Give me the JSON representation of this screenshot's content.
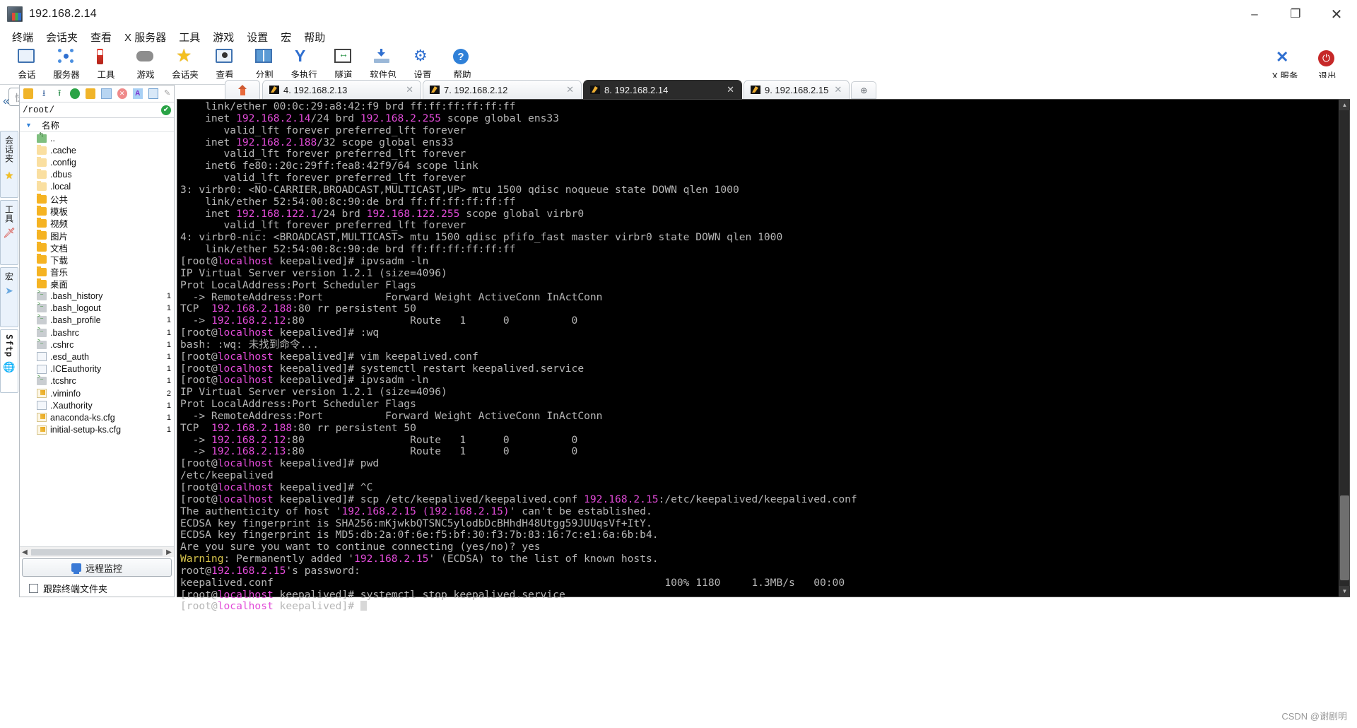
{
  "window": {
    "title": "192.168.2.14",
    "app_icon": "mobaxterm-icon",
    "minimize": "–",
    "maximize": "❐",
    "close": "✕"
  },
  "menubar": {
    "items": [
      {
        "label": "终端",
        "name": "menu-terminal"
      },
      {
        "label": "会话夹",
        "name": "menu-sessions"
      },
      {
        "label": "查看",
        "name": "menu-view"
      },
      {
        "label": "X 服务器",
        "name": "menu-xserver"
      },
      {
        "label": "工具",
        "name": "menu-tools"
      },
      {
        "label": "游戏",
        "name": "menu-games"
      },
      {
        "label": "设置",
        "name": "menu-settings"
      },
      {
        "label": "宏",
        "name": "menu-macros"
      },
      {
        "label": "帮助",
        "name": "menu-help"
      }
    ]
  },
  "toolbar": {
    "buttons": [
      {
        "label": "会话",
        "icon": "session-icon",
        "name": "toolbar-session"
      },
      {
        "label": "服务器",
        "icon": "servers-icon",
        "name": "toolbar-servers"
      },
      {
        "label": "工具",
        "icon": "tools-icon",
        "name": "toolbar-tools"
      },
      {
        "label": "游戏",
        "icon": "games-icon",
        "name": "toolbar-games"
      },
      {
        "label": "会话夹",
        "icon": "star-icon",
        "name": "toolbar-sessions-folder"
      },
      {
        "label": "查看",
        "icon": "view-icon",
        "name": "toolbar-view"
      },
      {
        "label": "分割",
        "icon": "split-icon",
        "name": "toolbar-split"
      },
      {
        "label": "多执行",
        "icon": "multiexec-icon",
        "name": "toolbar-multiexec"
      },
      {
        "label": "隧道",
        "icon": "tunnel-icon",
        "name": "toolbar-tunneling"
      },
      {
        "label": "软件包",
        "icon": "package-icon",
        "name": "toolbar-packages"
      },
      {
        "label": "设置",
        "icon": "gear-icon",
        "name": "toolbar-settings"
      },
      {
        "label": "帮助",
        "icon": "help-icon",
        "name": "toolbar-help"
      }
    ],
    "right_buttons": [
      {
        "label": "X 服务",
        "icon": "x-server-icon",
        "name": "toolbar-xserver"
      },
      {
        "label": "退出",
        "icon": "power-icon",
        "name": "toolbar-exit"
      }
    ]
  },
  "quick_connect": {
    "placeholder": "快速连接..."
  },
  "vertical_tabs": [
    {
      "label": "会话夹",
      "icon": "star-icon",
      "name": "vtab-sessions"
    },
    {
      "label": "工具",
      "icon": "tools-icon",
      "name": "vtab-tools"
    },
    {
      "label": "宏",
      "icon": "macro-icon",
      "name": "vtab-macros"
    },
    {
      "label": "Sftp",
      "icon": "globe-icon",
      "name": "vtab-sftp"
    }
  ],
  "sftp": {
    "collapse_icon": "chevron-left-double-icon",
    "toolbar_icons": [
      {
        "name": "parent-folder-icon"
      },
      {
        "name": "download-icon"
      },
      {
        "name": "upload-icon"
      },
      {
        "name": "refresh-icon"
      },
      {
        "name": "new-folder-icon"
      },
      {
        "name": "new-file-icon"
      },
      {
        "name": "delete-icon"
      },
      {
        "name": "text-mode-icon"
      },
      {
        "name": "view-mode-icon"
      },
      {
        "name": "edit-icon"
      }
    ],
    "path": "/root/",
    "path_status": "✔",
    "column_header": "名称",
    "files": [
      {
        "name": "..",
        "type": "up",
        "size": ""
      },
      {
        "name": ".cache",
        "type": "folder-pale",
        "size": ""
      },
      {
        "name": ".config",
        "type": "folder-pale",
        "size": ""
      },
      {
        "name": ".dbus",
        "type": "folder-pale",
        "size": ""
      },
      {
        "name": ".local",
        "type": "folder-pale",
        "size": ""
      },
      {
        "name": "公共",
        "type": "folder",
        "size": ""
      },
      {
        "name": "模板",
        "type": "folder",
        "size": ""
      },
      {
        "name": "视频",
        "type": "folder",
        "size": ""
      },
      {
        "name": "图片",
        "type": "folder",
        "size": ""
      },
      {
        "name": "文档",
        "type": "folder",
        "size": ""
      },
      {
        "name": "下载",
        "type": "folder",
        "size": ""
      },
      {
        "name": "音乐",
        "type": "folder",
        "size": ""
      },
      {
        "name": "桌面",
        "type": "folder",
        "size": ""
      },
      {
        "name": ".bash_history",
        "type": "sh",
        "size": "1"
      },
      {
        "name": ".bash_logout",
        "type": "sh",
        "size": "1"
      },
      {
        "name": ".bash_profile",
        "type": "sh",
        "size": "1"
      },
      {
        "name": ".bashrc",
        "type": "sh",
        "size": "1"
      },
      {
        "name": ".cshrc",
        "type": "sh",
        "size": "1"
      },
      {
        "name": ".esd_auth",
        "type": "doc",
        "size": "1"
      },
      {
        "name": ".ICEauthority",
        "type": "doc",
        "size": "1"
      },
      {
        "name": ".tcshrc",
        "type": "sh",
        "size": "1"
      },
      {
        "name": ".viminfo",
        "type": "docy",
        "size": "2"
      },
      {
        "name": ".Xauthority",
        "type": "doc",
        "size": "1"
      },
      {
        "name": "anaconda-ks.cfg",
        "type": "docy",
        "size": "1"
      },
      {
        "name": "initial-setup-ks.cfg",
        "type": "docy",
        "size": "1"
      }
    ],
    "remote_monitor_label": "远程监控",
    "follow_terminal_label": "跟踪终端文件夹",
    "follow_terminal_checked": false,
    "scroll_left": "◀",
    "scroll_right": "▶"
  },
  "tabs": {
    "home_icon": "home-icon",
    "items": [
      {
        "label": "4. 192.168.2.13",
        "active": false,
        "close": "✕",
        "name": "tab-4"
      },
      {
        "label": "7. 192.168.2.12",
        "active": false,
        "close": "✕",
        "name": "tab-7"
      },
      {
        "label": "8. 192.168.2.14",
        "active": true,
        "close": "✕",
        "name": "tab-8"
      },
      {
        "label": "9. 192.168.2.15",
        "active": false,
        "close": "✕",
        "name": "tab-9"
      }
    ],
    "new_tab_label": "⊕"
  },
  "terminal": {
    "lines": [
      [
        {
          "t": "    link/ether 00:0c:29:a8:42:f9 brd ff:ff:ff:ff:ff:ff",
          "c": "g"
        }
      ],
      [
        {
          "t": "    inet ",
          "c": "g"
        },
        {
          "t": "192.168.2.14",
          "c": "m"
        },
        {
          "t": "/24 brd ",
          "c": "g"
        },
        {
          "t": "192.168.2.255",
          "c": "m"
        },
        {
          "t": " scope global ens33",
          "c": "g"
        }
      ],
      [
        {
          "t": "       valid_lft forever preferred_lft forever",
          "c": "g"
        }
      ],
      [
        {
          "t": "    inet ",
          "c": "g"
        },
        {
          "t": "192.168.2.188",
          "c": "m"
        },
        {
          "t": "/32 scope global ens33",
          "c": "g"
        }
      ],
      [
        {
          "t": "       valid_lft forever preferred_lft forever",
          "c": "g"
        }
      ],
      [
        {
          "t": "    inet6 fe80::20c:29ff:fea8:42f9/64 scope link",
          "c": "g"
        }
      ],
      [
        {
          "t": "       valid_lft forever preferred_lft forever",
          "c": "g"
        }
      ],
      [
        {
          "t": "3: virbr0: <NO-CARRIER,BROADCAST,MULTICAST,UP> mtu 1500 qdisc noqueue state DOWN qlen 1000",
          "c": "g"
        }
      ],
      [
        {
          "t": "    link/ether 52:54:00:8c:90:de brd ff:ff:ff:ff:ff:ff",
          "c": "g"
        }
      ],
      [
        {
          "t": "    inet ",
          "c": "g"
        },
        {
          "t": "192.168.122.1",
          "c": "m"
        },
        {
          "t": "/24 brd ",
          "c": "g"
        },
        {
          "t": "192.168.122.255",
          "c": "m"
        },
        {
          "t": " scope global virbr0",
          "c": "g"
        }
      ],
      [
        {
          "t": "       valid_lft forever preferred_lft forever",
          "c": "g"
        }
      ],
      [
        {
          "t": "4: virbr0-nic: <BROADCAST,MULTICAST> mtu 1500 qdisc pfifo_fast master virbr0 state DOWN qlen 1000",
          "c": "g"
        }
      ],
      [
        {
          "t": "    link/ether 52:54:00:8c:90:de brd ff:ff:ff:ff:ff:ff",
          "c": "g"
        }
      ],
      [
        {
          "t": "[root@",
          "c": "g"
        },
        {
          "t": "localhost",
          "c": "m"
        },
        {
          "t": " keepalived]# ipvsadm -ln",
          "c": "g"
        }
      ],
      [
        {
          "t": "IP Virtual Server version 1.2.1 (size=4096)",
          "c": "g"
        }
      ],
      [
        {
          "t": "Prot LocalAddress:Port Scheduler Flags",
          "c": "g"
        }
      ],
      [
        {
          "t": "  -> RemoteAddress:Port          Forward Weight ActiveConn InActConn",
          "c": "g"
        }
      ],
      [
        {
          "t": "TCP  ",
          "c": "g"
        },
        {
          "t": "192.168.2.188",
          "c": "m"
        },
        {
          "t": ":80 rr persistent 50",
          "c": "g"
        }
      ],
      [
        {
          "t": "  -> ",
          "c": "g"
        },
        {
          "t": "192.168.2.12",
          "c": "m"
        },
        {
          "t": ":80                 Route   1      0          0",
          "c": "g"
        }
      ],
      [
        {
          "t": "[root@",
          "c": "g"
        },
        {
          "t": "localhost",
          "c": "m"
        },
        {
          "t": " keepalived]# :wq",
          "c": "g"
        }
      ],
      [
        {
          "t": "bash: :wq: 未找到命令...",
          "c": "g"
        }
      ],
      [
        {
          "t": "[root@",
          "c": "g"
        },
        {
          "t": "localhost",
          "c": "m"
        },
        {
          "t": " keepalived]# vim keepalived.conf",
          "c": "g"
        }
      ],
      [
        {
          "t": "[root@",
          "c": "g"
        },
        {
          "t": "localhost",
          "c": "m"
        },
        {
          "t": " keepalived]# systemctl restart keepalived.service",
          "c": "g"
        }
      ],
      [
        {
          "t": "[root@",
          "c": "g"
        },
        {
          "t": "localhost",
          "c": "m"
        },
        {
          "t": " keepalived]# ipvsadm -ln",
          "c": "g"
        }
      ],
      [
        {
          "t": "IP Virtual Server version 1.2.1 (size=4096)",
          "c": "g"
        }
      ],
      [
        {
          "t": "Prot LocalAddress:Port Scheduler Flags",
          "c": "g"
        }
      ],
      [
        {
          "t": "  -> RemoteAddress:Port          Forward Weight ActiveConn InActConn",
          "c": "g"
        }
      ],
      [
        {
          "t": "TCP  ",
          "c": "g"
        },
        {
          "t": "192.168.2.188",
          "c": "m"
        },
        {
          "t": ":80 rr persistent 50",
          "c": "g"
        }
      ],
      [
        {
          "t": "  -> ",
          "c": "g"
        },
        {
          "t": "192.168.2.12",
          "c": "m"
        },
        {
          "t": ":80                 Route   1      0          0",
          "c": "g"
        }
      ],
      [
        {
          "t": "  -> ",
          "c": "g"
        },
        {
          "t": "192.168.2.13",
          "c": "m"
        },
        {
          "t": ":80                 Route   1      0          0",
          "c": "g"
        }
      ],
      [
        {
          "t": "[root@",
          "c": "g"
        },
        {
          "t": "localhost",
          "c": "m"
        },
        {
          "t": " keepalived]# pwd",
          "c": "g"
        }
      ],
      [
        {
          "t": "/etc/keepalived",
          "c": "g"
        }
      ],
      [
        {
          "t": "[root@",
          "c": "g"
        },
        {
          "t": "localhost",
          "c": "m"
        },
        {
          "t": " keepalived]# ^C",
          "c": "g"
        }
      ],
      [
        {
          "t": "[root@",
          "c": "g"
        },
        {
          "t": "localhost",
          "c": "m"
        },
        {
          "t": " keepalived]# scp /etc/keepalived/keepalived.conf ",
          "c": "g"
        },
        {
          "t": "192.168.2.15",
          "c": "m"
        },
        {
          "t": ":/etc/keepalived/keepalived.conf",
          "c": "g"
        }
      ],
      [
        {
          "t": "The authenticity of host '",
          "c": "g"
        },
        {
          "t": "192.168.2.15 (192.168.2.15)",
          "c": "m"
        },
        {
          "t": "' can't be established.",
          "c": "g"
        }
      ],
      [
        {
          "t": "ECDSA key fingerprint is SHA256:mKjwkbQTSNC5ylodbDcBHhdH48Utgg59JUUqsVf+ItY.",
          "c": "g"
        }
      ],
      [
        {
          "t": "ECDSA key fingerprint is MD5:db:2a:0f:6e:f5:bf:30:f3:7b:83:16:7c:e1:6a:6b:b4.",
          "c": "g"
        }
      ],
      [
        {
          "t": "Are you sure you want to continue connecting (yes/no)? yes",
          "c": "g"
        }
      ],
      [
        {
          "t": "Warning",
          "c": "y"
        },
        {
          "t": ": Permanently added '",
          "c": "g"
        },
        {
          "t": "192.168.2.15",
          "c": "m"
        },
        {
          "t": "' (ECDSA) to the list of known hosts.",
          "c": "g"
        }
      ],
      [
        {
          "t": "root@",
          "c": "g"
        },
        {
          "t": "192.168.2.15",
          "c": "m"
        },
        {
          "t": "'s password:",
          "c": "g"
        }
      ],
      [
        {
          "t": "keepalived.conf                                                               100% 1180     1.3MB/s   00:00",
          "c": "g"
        }
      ],
      [
        {
          "t": "[root@",
          "c": "g"
        },
        {
          "t": "localhost",
          "c": "m"
        },
        {
          "t": " keepalived]# systemctl stop keepalived.service",
          "c": "g"
        }
      ],
      [
        {
          "t": "[root@",
          "c": "g"
        },
        {
          "t": "localhost",
          "c": "m"
        },
        {
          "t": " keepalived]# ",
          "c": "g"
        },
        {
          "t": "█",
          "c": "cur"
        }
      ]
    ],
    "scroll_up": "▲",
    "scroll_down": "▼"
  },
  "watermark": "CSDN @谢剧明"
}
